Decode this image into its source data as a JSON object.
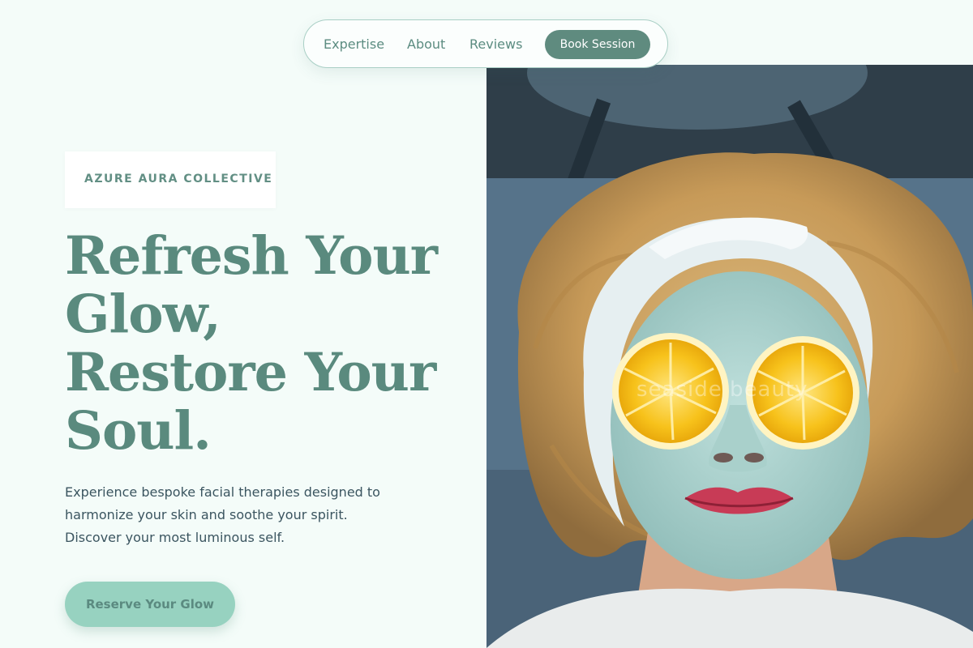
{
  "nav": {
    "links": [
      "Expertise",
      "About",
      "Reviews"
    ],
    "cta": "Book Session"
  },
  "hero": {
    "badge": "AZURE AURA COLLECTIVE",
    "headline_lines": [
      "Refresh Your",
      "Glow,",
      "Restore Your",
      "Soul."
    ],
    "sub_lines": [
      "Experience bespoke facial therapies designed to",
      "harmonize your skin and soothe your spirit.",
      "Discover your most luminous self."
    ],
    "cta": "Reserve Your Glow"
  },
  "image": {
    "watermark": "seaside beauty"
  },
  "colors": {
    "page_bg": "#f4fcf9",
    "brand_green": "#5a8a7e",
    "accent_mint": "#97d2c0",
    "nav_button": "#5f8b7f"
  }
}
